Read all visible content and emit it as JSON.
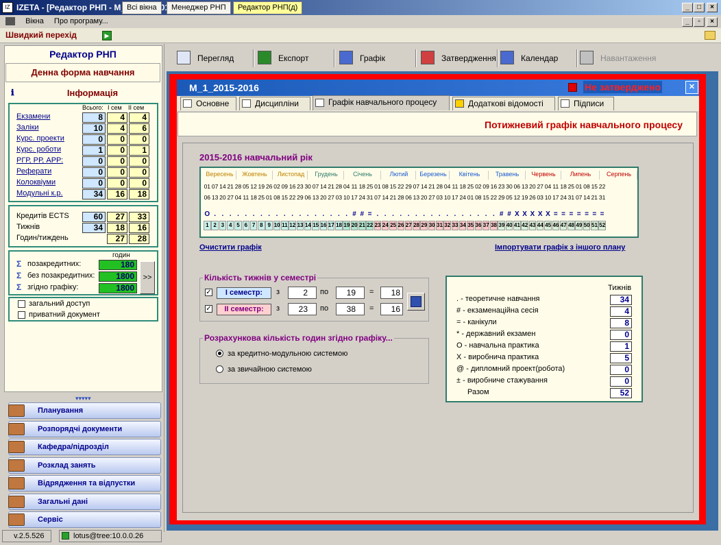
{
  "window": {
    "title": "IZETA - [Редактор РНП - М_1_2015-2016]",
    "icon_text": "IZ"
  },
  "menu": {
    "items": [
      "Вікна",
      "Про програму..."
    ]
  },
  "quickbar": {
    "label": "Швидкий перехід",
    "tabs": [
      "Всі вікна",
      "Менеджер РНП",
      "Редактор РНП(д)"
    ]
  },
  "left": {
    "title": "Редактор РНП",
    "form": "Денна форма навчання",
    "info_title": "Інформація",
    "col_headers": [
      "Всього:",
      "I сем",
      "II сем"
    ],
    "rows": [
      {
        "label": "Екзамени",
        "v": [
          "8",
          "4",
          "4"
        ]
      },
      {
        "label": "Заліки",
        "v": [
          "10",
          "4",
          "6"
        ]
      },
      {
        "label": "Курс. проекти",
        "v": [
          "0",
          "0",
          "0"
        ]
      },
      {
        "label": "Курс. роботи",
        "v": [
          "1",
          "0",
          "1"
        ]
      },
      {
        "label": "РГР, РР, АРР:",
        "v": [
          "0",
          "0",
          "0"
        ]
      },
      {
        "label": "Реферати",
        "v": [
          "0",
          "0",
          "0"
        ]
      },
      {
        "label": "Колоквіуми",
        "v": [
          "0",
          "0",
          "0"
        ]
      },
      {
        "label": "Модульні к.р.",
        "v": [
          "34",
          "16",
          "18"
        ]
      }
    ],
    "credits": [
      {
        "label": "Кредитів ECTS",
        "v": [
          "60",
          "27",
          "33"
        ]
      },
      {
        "label": "Тижнів",
        "v": [
          "34",
          "18",
          "16"
        ]
      },
      {
        "label": "Годин/тиждень",
        "v": [
          "27",
          "28"
        ]
      }
    ],
    "hours_header": "годин",
    "hours": [
      {
        "label": "позакредитних:",
        "v": "180"
      },
      {
        "label": "без позакредитних:",
        "v": "1800"
      },
      {
        "label": "згідно графіку:",
        "v": "1800"
      }
    ],
    "expand_label": ">>",
    "checks": [
      "загальний доступ",
      "приватний документ"
    ],
    "nav": [
      "Планування",
      "Розпорядчі документи",
      "Кафедра/підрозділ",
      "Розклад занять",
      "Відрядження та відпустки",
      "Загальні дані",
      "Сервіс"
    ],
    "status_version": "v.2.5.526",
    "status_user": "lotus@tree:10.0.0.26"
  },
  "toolbar": {
    "buttons": [
      "Перегляд",
      "Експорт",
      "Графік",
      "Затвердження",
      "Календар",
      "Навантаження"
    ]
  },
  "doc": {
    "title": "М_1_2015-2016",
    "status": "Не затверджено",
    "tabs": [
      "Основне",
      "Дисципліни",
      "Графік навчального процесу",
      "Додаткові відомості",
      "Підписи"
    ],
    "header": "Потижневий графік навчального процесу",
    "year_title": "2015-2016 навчальний рік",
    "months": [
      "Вересень",
      "Жовтень",
      "Листопад",
      "Грудень",
      "Січень",
      "Лютий",
      "Березень",
      "Квітень",
      "Травень",
      "Червень",
      "Липень",
      "Серпень"
    ],
    "dates_top": [
      "01",
      "07",
      "14",
      "21",
      "28",
      "05",
      "12",
      "19",
      "26",
      "02",
      "09",
      "16",
      "23",
      "30",
      "07",
      "14",
      "21",
      "28",
      "04",
      "11",
      "18",
      "25",
      "01",
      "08",
      "15",
      "22",
      "29",
      "07",
      "14",
      "21",
      "28",
      "04",
      "11",
      "18",
      "25",
      "02",
      "09",
      "16",
      "23",
      "30",
      "06",
      "13",
      "20",
      "27",
      "04",
      "11",
      "18",
      "25",
      "01",
      "08",
      "15",
      "22"
    ],
    "dates_bot": [
      "06",
      "13",
      "20",
      "27",
      "04",
      "11",
      "18",
      "25",
      "01",
      "08",
      "15",
      "22",
      "29",
      "06",
      "13",
      "20",
      "27",
      "03",
      "10",
      "17",
      "24",
      "31",
      "07",
      "14",
      "21",
      "28",
      "06",
      "13",
      "20",
      "27",
      "03",
      "10",
      "17",
      "24",
      "01",
      "08",
      "15",
      "22",
      "29",
      "05",
      "12",
      "19",
      "26",
      "03",
      "10",
      "17",
      "24",
      "31",
      "07",
      "14",
      "21",
      "31"
    ],
    "marks": [
      "О",
      ".",
      ".",
      ".",
      ".",
      ".",
      ".",
      ".",
      ".",
      ".",
      ".",
      ".",
      ".",
      ".",
      ".",
      ".",
      ".",
      ".",
      ".",
      "#",
      "#",
      "=",
      ".",
      ".",
      ".",
      ".",
      ".",
      ".",
      ".",
      ".",
      ".",
      ".",
      ".",
      ".",
      ".",
      ".",
      ".",
      ".",
      "#",
      "#",
      "X",
      "X",
      "X",
      "X",
      "X",
      "=",
      "=",
      "=",
      "=",
      "=",
      "=",
      "="
    ],
    "weeks": [
      "1",
      "2",
      "3",
      "4",
      "5",
      "6",
      "7",
      "8",
      "9",
      "10",
      "11",
      "12",
      "13",
      "14",
      "15",
      "16",
      "17",
      "18",
      "19",
      "20",
      "21",
      "22",
      "23",
      "24",
      "25",
      "26",
      "27",
      "28",
      "29",
      "30",
      "31",
      "32",
      "33",
      "34",
      "35",
      "36",
      "37",
      "38",
      "39",
      "40",
      "41",
      "42",
      "43",
      "44",
      "45",
      "46",
      "47",
      "48",
      "49",
      "50",
      "51",
      "52"
    ],
    "clear_link": "Очистити графік",
    "import_link": "Імпортувати графік з іншого плану",
    "weeks_group": "Кількість тижнів у семестрі",
    "sem1": {
      "label": "I семестр:",
      "from": "2",
      "to": "19",
      "total": "18"
    },
    "sem2": {
      "label": "II семестр:",
      "from": "23",
      "to": "38",
      "total": "16"
    },
    "word_from": "з",
    "word_to": "по",
    "word_eq": "=",
    "calc_group": "Розрахункова кількість годин згідно графіку...",
    "radio1": "за кредитно-модульною системою",
    "radio2": "за звичайною системою",
    "legend_header": "Тижнів",
    "legend": [
      {
        "label": ". - теоретичне навчання",
        "v": "34"
      },
      {
        "label": "# - екзаменаційна сесія",
        "v": "4"
      },
      {
        "label": "= - канікули",
        "v": "8"
      },
      {
        "label": "* - державний екзамен",
        "v": "0"
      },
      {
        "label": "О - навчальна практика",
        "v": "1"
      },
      {
        "label": "Х - виробнича практика",
        "v": "5"
      },
      {
        "label": "@ - дипломний проект(робота)",
        "v": "0"
      },
      {
        "label": "± - виробниче стажування",
        "v": "0"
      },
      {
        "label": "Разом",
        "v": "52"
      }
    ]
  }
}
